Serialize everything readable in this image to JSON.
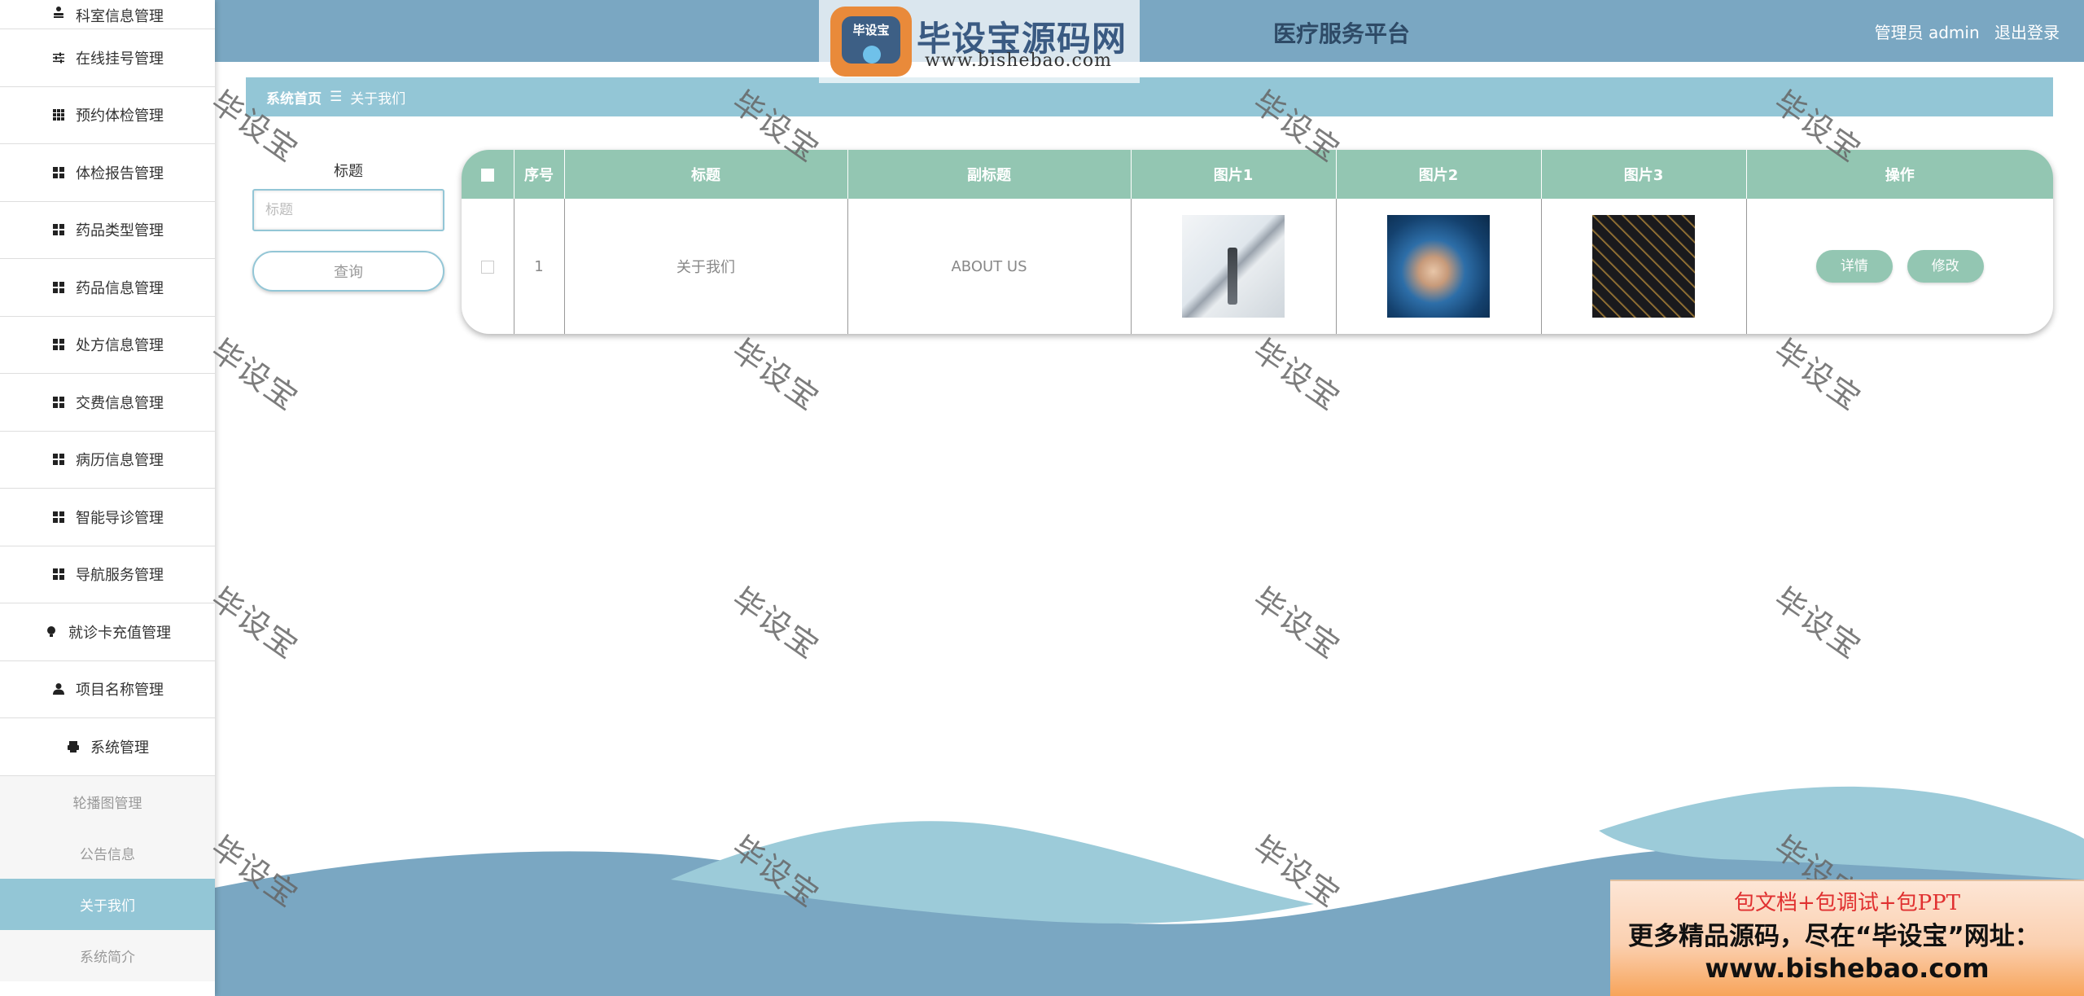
{
  "app": {
    "title": "医疗服务平台",
    "user_label": "管理员 admin",
    "logout_label": "退出登录"
  },
  "logo": {
    "badge_text": "毕设宝",
    "name": "毕设宝源码网",
    "url": "www.bishebao.com"
  },
  "sidebar": {
    "items": [
      {
        "label": "科室信息管理",
        "icon": "user-upload-icon"
      },
      {
        "label": "在线挂号管理",
        "icon": "sliders-icon"
      },
      {
        "label": "预约体检管理",
        "icon": "grid-dots-icon"
      },
      {
        "label": "体检报告管理",
        "icon": "grid-icon"
      },
      {
        "label": "药品类型管理",
        "icon": "grid-icon"
      },
      {
        "label": "药品信息管理",
        "icon": "grid-icon"
      },
      {
        "label": "处方信息管理",
        "icon": "grid-icon"
      },
      {
        "label": "交费信息管理",
        "icon": "grid-icon"
      },
      {
        "label": "病历信息管理",
        "icon": "grid-icon"
      },
      {
        "label": "智能导诊管理",
        "icon": "grid-icon"
      },
      {
        "label": "导航服务管理",
        "icon": "grid-icon"
      },
      {
        "label": "就诊卡充值管理",
        "icon": "bulb-icon"
      },
      {
        "label": "项目名称管理",
        "icon": "user-icon"
      },
      {
        "label": "系统管理",
        "icon": "printer-icon"
      }
    ],
    "sub_items": [
      {
        "label": "轮播图管理"
      },
      {
        "label": "公告信息"
      },
      {
        "label": "关于我们"
      },
      {
        "label": "系统简介"
      }
    ]
  },
  "breadcrumb": {
    "home": "系统首页",
    "separator": "☰",
    "current": "关于我们"
  },
  "search": {
    "label": "标题",
    "placeholder": "标题",
    "button": "查询"
  },
  "table": {
    "headers": [
      "序号",
      "标题",
      "副标题",
      "图片1",
      "图片2",
      "图片3",
      "操作"
    ],
    "rows": [
      {
        "index": "1",
        "title": "关于我们",
        "subtitle": "ABOUT US",
        "detail_label": "详情",
        "edit_label": "修改"
      }
    ]
  },
  "watermark": {
    "text": "毕设宝"
  },
  "promo": {
    "line1": "包文档+包调试+包PPT",
    "line2": "更多精品源码，尽在“毕设宝”网址：",
    "line3": "www.bishebao.com"
  },
  "colors": {
    "header": "#7aa7c2",
    "accent": "#93c6d6",
    "table_header": "#93c6b2"
  }
}
